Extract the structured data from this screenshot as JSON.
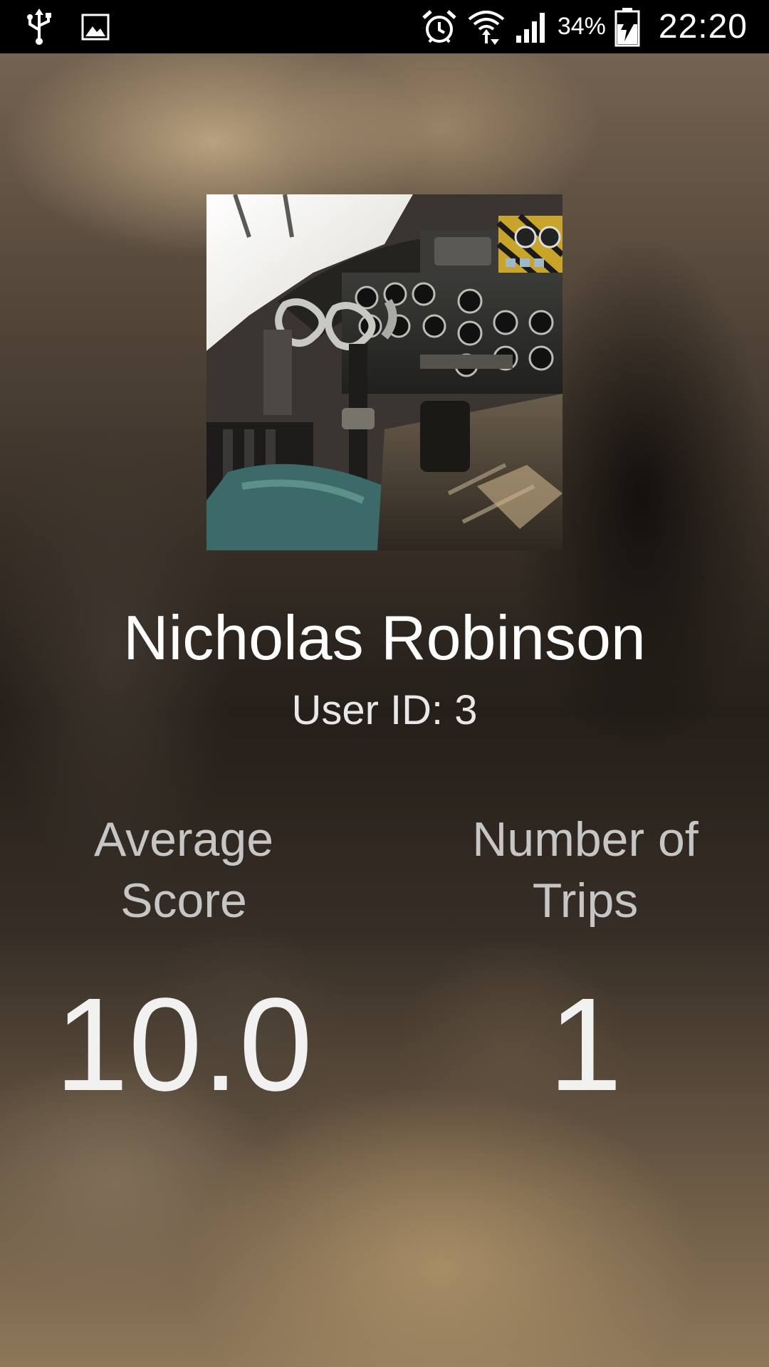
{
  "status_bar": {
    "battery_percent": "34%",
    "time": "22:20",
    "icons": [
      "usb-icon",
      "image-icon",
      "alarm-icon",
      "wifi-icon",
      "signal-icon",
      "battery-charging-icon"
    ]
  },
  "profile": {
    "name": "Nicholas Robinson",
    "user_id": "User ID: 3"
  },
  "stats": {
    "average_score": {
      "label_line1": "Average",
      "label_line2": "Score",
      "value": "10.0"
    },
    "number_of_trips": {
      "label_line1": "Number of",
      "label_line2": "Trips",
      "value": "1"
    }
  },
  "colors": {
    "status_bar_bg": "#000000",
    "text_primary": "#ffffff",
    "text_secondary": "#c6c6c6"
  }
}
